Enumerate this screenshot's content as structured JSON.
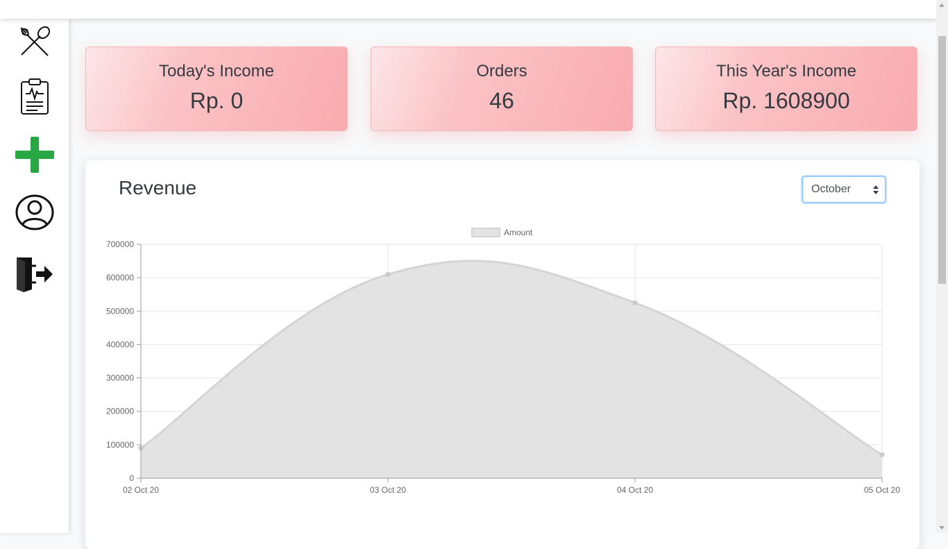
{
  "sidebar": {
    "items": [
      {
        "icon": "utensils-icon",
        "label": ""
      },
      {
        "icon": "clipboard-icon",
        "label": ""
      },
      {
        "icon": "plus-icon",
        "label": ""
      },
      {
        "icon": "user-icon",
        "label": ""
      },
      {
        "icon": "logout-icon",
        "label": ""
      }
    ],
    "colors": {
      "plus": "#28a745",
      "icon": "#111111"
    }
  },
  "stats": [
    {
      "label": "Today's Income",
      "value": "Rp. 0"
    },
    {
      "label": "Orders",
      "value": "46"
    },
    {
      "label": "This Year's Income",
      "value": "Rp. 1608900"
    }
  ],
  "revenue": {
    "title": "Revenue",
    "month_select": {
      "selected": "October"
    }
  },
  "chart_data": {
    "type": "area",
    "title": "",
    "x": [
      "02 Oct 20",
      "03 Oct 20",
      "04 Oct 20",
      "05 Oct 20"
    ],
    "series": [
      {
        "name": "Amount",
        "values": [
          90000,
          610000,
          525000,
          70000
        ]
      }
    ],
    "ylim": [
      0,
      700000
    ],
    "yticks": [
      0,
      100000,
      200000,
      300000,
      400000,
      500000,
      600000,
      700000
    ],
    "xlabel": "",
    "ylabel": "",
    "grid": true,
    "legend": "top",
    "colors": {
      "fill": "#e3e3e3",
      "line": "#d4d4d4",
      "grid": "#e5e5e5"
    }
  }
}
